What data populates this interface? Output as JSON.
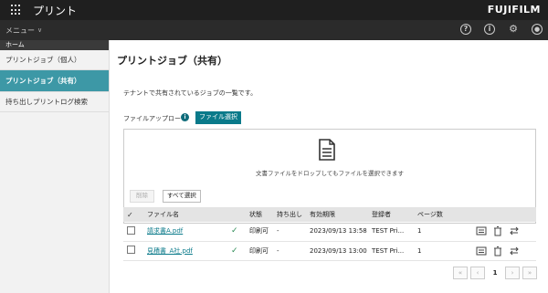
{
  "app": {
    "title": "プリント",
    "brand": "FUJIFILM"
  },
  "menubar": {
    "menu_label": "メニュー",
    "icons": [
      "help-icon",
      "info-icon",
      "settings-icon",
      "user-icon"
    ]
  },
  "sidebar": {
    "section": "ホーム",
    "items": [
      {
        "label": "プリントジョブ（個人）"
      },
      {
        "label": "プリントジョブ（共有）"
      },
      {
        "label": "持ち出しプリントログ検索"
      }
    ]
  },
  "main": {
    "title": "プリントジョブ（共有）",
    "description": "テナントで共有されているジョブの一覧です。",
    "upload_label": "ファイルアップロード",
    "file_select_label": "ファイル選択",
    "drop_text": "文書ファイルをドロップしてもファイルを選択できます",
    "delete_label": "削除",
    "select_all_label": "すべて選択"
  },
  "table": {
    "headers": [
      "ファイル名",
      "状態",
      "持ち出し",
      "有効期限",
      "登録者",
      "ページ数"
    ],
    "rows": [
      {
        "file": "請求書A.pdf",
        "status": "印刷可",
        "takeout": "-",
        "expiry": "2023/09/13 13:58",
        "registrant": "TEST Pri...",
        "pages": "1"
      },
      {
        "file": "見積書_A社.pdf",
        "status": "印刷可",
        "takeout": "-",
        "expiry": "2023/09/13 13:00",
        "registrant": "TEST Pri...",
        "pages": "1"
      }
    ]
  },
  "pagination": {
    "current": "1"
  },
  "colors": {
    "accent": "#0a7a8a",
    "sidebar_active": "#3d98a6",
    "topbar": "#1f1f1f"
  }
}
